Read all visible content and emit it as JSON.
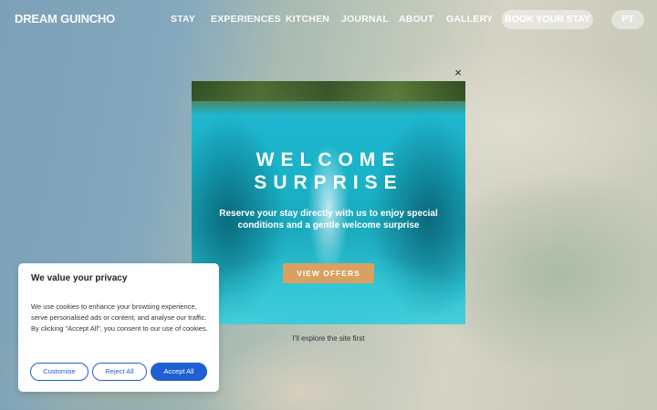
{
  "nav": {
    "logo": "DREAM GUINCHO",
    "links": [
      "STAY",
      "EXPERIENCES",
      "KITCHEN",
      "JOURNAL",
      "ABOUT",
      "GALLERY"
    ],
    "book_label": "BOOK YOUR STAY",
    "lang_label": "PT"
  },
  "popup": {
    "close_glyph": "×",
    "title_line1": "WELCOME",
    "title_line2": "SURPRISE",
    "subtext": "Reserve your stay directly with us to enjoy special conditions and a gentle welcome surprise",
    "cta_label": "VIEW OFFERS",
    "dismiss_label": "I'll explore the site first"
  },
  "cookie": {
    "title": "We value your privacy",
    "text": "We use cookies to enhance your browsing experience, serve personalised ads or content, and analyse our traffic. By clicking \"Accept All\", you consent to our use of cookies.",
    "customise_label": "Customise",
    "reject_label": "Reject All",
    "accept_label": "Accept All"
  },
  "colors": {
    "accent_blue": "#1f5fd1",
    "cta_orange": "#d9a062"
  }
}
